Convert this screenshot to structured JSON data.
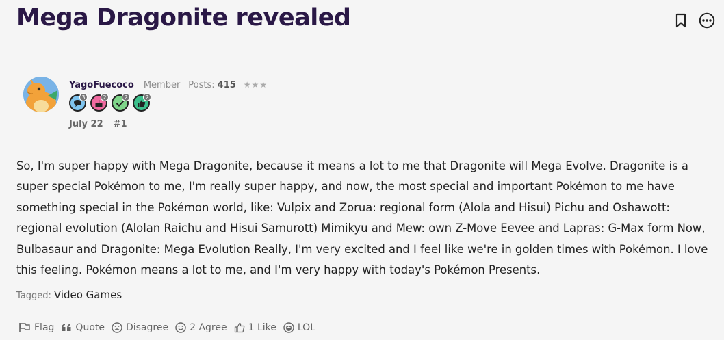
{
  "thread": {
    "title": "Mega Dragonite revealed"
  },
  "header": {
    "bookmark_icon": "bookmark-icon",
    "more_icon": "more-options-icon"
  },
  "post": {
    "author": "YagoFuecoco",
    "role": "Member",
    "posts_label": "Posts:",
    "posts_count": "415",
    "stars": "★★★",
    "badges": [
      {
        "icon": "comment-badge-icon",
        "count": "3",
        "color": "#7fc4ef"
      },
      {
        "icon": "cake-badge-icon",
        "count": "2",
        "color": "#f06aa0"
      },
      {
        "icon": "check-badge-icon",
        "count": "2",
        "color": "#7fd68a"
      },
      {
        "icon": "thumbs-up-badge-icon",
        "count": "2",
        "color": "#3cc08c"
      }
    ],
    "date": "July 22",
    "number": "#1",
    "body": "So, I'm super happy with Mega Dragonite, because it means a lot to me that Dragonite will Mega Evolve. Dragonite is a super special Pokémon to me, I'm really super happy, and now, the most special and important Pokémon to me have something special in the Pokémon world, like: Vulpix and Zorua: regional form (Alola and Hisui) Pichu and Oshawott: regional evolution (Alolan Raichu and Hisui Samurott) Mimikyu and Mew: own Z-Move Eevee and Lapras: G-Max form Now, Bulbasaur and Dragonite: Mega Evolution Really, I'm very excited and I feel like we're in golden times with Pokémon. I love this feeling. Pokémon means a lot to me, and I'm very happy with today's Pokémon Presents.",
    "tags_label": "Tagged:",
    "tag": "Video Games"
  },
  "reactions": {
    "flag": "Flag",
    "quote": "Quote",
    "disagree": "Disagree",
    "agree": "2 Agree",
    "like": "1 Like",
    "lol": "LOL"
  }
}
